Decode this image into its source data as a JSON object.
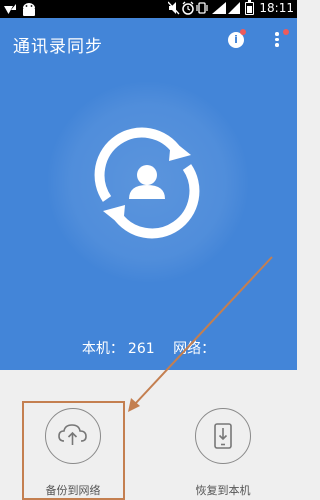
{
  "status_bar": {
    "time": "18:11",
    "icons": [
      "wifi-signal-icon",
      "android-icon",
      "mute-icon",
      "alarm-icon",
      "vibrate-icon",
      "signal-icon",
      "battery-icon"
    ]
  },
  "header": {
    "title": "通讯录同步",
    "info_icon": "i",
    "menu_icon": "more-vertical-icon"
  },
  "counts": {
    "local_label": "本机：",
    "local_value": "261",
    "network_label": "网络："
  },
  "actions": [
    {
      "label": "备份到网络",
      "icon": "cloud-upload-icon"
    },
    {
      "label": "恢复到本机",
      "icon": "phone-download-icon"
    }
  ],
  "colors": {
    "primary": "#4385d8",
    "background": "#efefef",
    "badge": "#ee5b5b",
    "annotation": "#c47f50"
  }
}
